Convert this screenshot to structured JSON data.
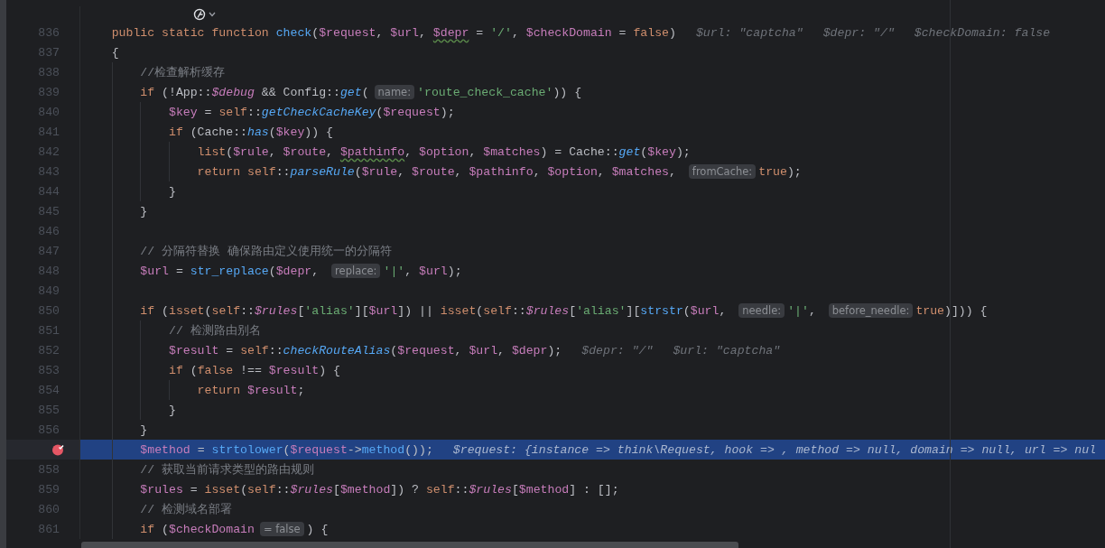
{
  "editor": {
    "lines": [
      {
        "number": "836",
        "tokens": [
          {
            "text": "    public static function ",
            "kind": "kw"
          },
          {
            "text": "check",
            "kind": "fn"
          },
          {
            "text": "(",
            "kind": "txt"
          },
          {
            "text": "$request",
            "kind": "var"
          },
          {
            "text": ", ",
            "kind": "txt"
          },
          {
            "text": "$url",
            "kind": "var"
          },
          {
            "text": ", ",
            "kind": "txt"
          },
          {
            "text": "$depr",
            "kind": "var",
            "warn": true
          },
          {
            "text": " = ",
            "kind": "txt"
          },
          {
            "text": "'/'",
            "kind": "str"
          },
          {
            "text": ", ",
            "kind": "txt"
          },
          {
            "text": "$checkDomain",
            "kind": "var"
          },
          {
            "text": " = ",
            "kind": "txt"
          },
          {
            "text": "false",
            "kind": "kw"
          },
          {
            "text": ")",
            "kind": "txt"
          },
          {
            "text": "$url: \"captcha\"",
            "kind": "val"
          },
          {
            "text": "$depr: \"/\"",
            "kind": "val"
          },
          {
            "text": "$checkDomain: false",
            "kind": "val"
          }
        ]
      },
      {
        "number": "837",
        "tokens": [
          {
            "text": "    {",
            "kind": "txt"
          }
        ]
      },
      {
        "number": "838",
        "tokens": [
          {
            "text": "        //检查解析缓存",
            "kind": "cmt"
          }
        ]
      },
      {
        "number": "839",
        "tokens": [
          {
            "text": "        if",
            "kind": "kw"
          },
          {
            "text": " (!App::",
            "kind": "txt"
          },
          {
            "text": "$debug",
            "kind": "ivar"
          },
          {
            "text": " && Config::",
            "kind": "txt"
          },
          {
            "text": "get",
            "kind": "ifn"
          },
          {
            "text": "(",
            "kind": "txt"
          },
          {
            "text": "name:",
            "kind": "hint"
          },
          {
            "text": "'route_check_cache'",
            "kind": "str"
          },
          {
            "text": ")) {",
            "kind": "txt"
          }
        ]
      },
      {
        "number": "840",
        "tokens": [
          {
            "text": "            $key",
            "kind": "var"
          },
          {
            "text": " = ",
            "kind": "txt"
          },
          {
            "text": "self",
            "kind": "kw"
          },
          {
            "text": "::",
            "kind": "txt"
          },
          {
            "text": "getCheckCacheKey",
            "kind": "ifn"
          },
          {
            "text": "(",
            "kind": "txt"
          },
          {
            "text": "$request",
            "kind": "var"
          },
          {
            "text": ");",
            "kind": "txt"
          }
        ]
      },
      {
        "number": "841",
        "tokens": [
          {
            "text": "            if",
            "kind": "kw"
          },
          {
            "text": " (Cache::",
            "kind": "txt"
          },
          {
            "text": "has",
            "kind": "ifn"
          },
          {
            "text": "(",
            "kind": "txt"
          },
          {
            "text": "$key",
            "kind": "var"
          },
          {
            "text": ")) {",
            "kind": "txt"
          }
        ]
      },
      {
        "number": "842",
        "tokens": [
          {
            "text": "                list",
            "kind": "kw"
          },
          {
            "text": "(",
            "kind": "txt"
          },
          {
            "text": "$rule",
            "kind": "var"
          },
          {
            "text": ", ",
            "kind": "txt"
          },
          {
            "text": "$route",
            "kind": "var"
          },
          {
            "text": ", ",
            "kind": "txt"
          },
          {
            "text": "$pathinfo",
            "kind": "var",
            "warn": true
          },
          {
            "text": ", ",
            "kind": "txt"
          },
          {
            "text": "$option",
            "kind": "var"
          },
          {
            "text": ", ",
            "kind": "txt"
          },
          {
            "text": "$matches",
            "kind": "var"
          },
          {
            "text": ") = Cache::",
            "kind": "txt"
          },
          {
            "text": "get",
            "kind": "ifn"
          },
          {
            "text": "(",
            "kind": "txt"
          },
          {
            "text": "$key",
            "kind": "var"
          },
          {
            "text": ");",
            "kind": "txt"
          }
        ]
      },
      {
        "number": "843",
        "tokens": [
          {
            "text": "                return ",
            "kind": "kw"
          },
          {
            "text": "self",
            "kind": "kw"
          },
          {
            "text": "::",
            "kind": "txt"
          },
          {
            "text": "parseRule",
            "kind": "ifn"
          },
          {
            "text": "(",
            "kind": "txt"
          },
          {
            "text": "$rule",
            "kind": "var"
          },
          {
            "text": ", ",
            "kind": "txt"
          },
          {
            "text": "$route",
            "kind": "var"
          },
          {
            "text": ", ",
            "kind": "txt"
          },
          {
            "text": "$pathinfo",
            "kind": "var"
          },
          {
            "text": ", ",
            "kind": "txt"
          },
          {
            "text": "$option",
            "kind": "var"
          },
          {
            "text": ", ",
            "kind": "txt"
          },
          {
            "text": "$matches",
            "kind": "var"
          },
          {
            "text": ", ",
            "kind": "txt"
          },
          {
            "text": "fromCache:",
            "kind": "hint"
          },
          {
            "text": "true",
            "kind": "kw"
          },
          {
            "text": ");",
            "kind": "txt"
          }
        ]
      },
      {
        "number": "844",
        "tokens": [
          {
            "text": "            }",
            "kind": "txt"
          }
        ]
      },
      {
        "number": "845",
        "tokens": [
          {
            "text": "        }",
            "kind": "txt"
          }
        ]
      },
      {
        "number": "846"
      },
      {
        "number": "847",
        "tokens": [
          {
            "text": "        // 分隔符替换 确保路由定义使用统一的分隔符",
            "kind": "cmt"
          }
        ]
      },
      {
        "number": "848",
        "tokens": [
          {
            "text": "        $url",
            "kind": "var"
          },
          {
            "text": " = ",
            "kind": "txt"
          },
          {
            "text": "str_replace",
            "kind": "fn"
          },
          {
            "text": "(",
            "kind": "txt"
          },
          {
            "text": "$depr",
            "kind": "var"
          },
          {
            "text": ", ",
            "kind": "txt"
          },
          {
            "text": "replace:",
            "kind": "hint"
          },
          {
            "text": "'|'",
            "kind": "str"
          },
          {
            "text": ", ",
            "kind": "txt"
          },
          {
            "text": "$url",
            "kind": "var"
          },
          {
            "text": ");",
            "kind": "txt"
          }
        ]
      },
      {
        "number": "849"
      },
      {
        "number": "850",
        "tokens": [
          {
            "text": "        if",
            "kind": "kw"
          },
          {
            "text": " (",
            "kind": "txt"
          },
          {
            "text": "isset",
            "kind": "kw"
          },
          {
            "text": "(",
            "kind": "txt"
          },
          {
            "text": "self",
            "kind": "kw"
          },
          {
            "text": "::",
            "kind": "txt"
          },
          {
            "text": "$rules",
            "kind": "ivar"
          },
          {
            "text": "[",
            "kind": "txt"
          },
          {
            "text": "'alias'",
            "kind": "str"
          },
          {
            "text": "][",
            "kind": "txt"
          },
          {
            "text": "$url",
            "kind": "var"
          },
          {
            "text": "]) || ",
            "kind": "txt"
          },
          {
            "text": "isset",
            "kind": "kw"
          },
          {
            "text": "(",
            "kind": "txt"
          },
          {
            "text": "self",
            "kind": "kw"
          },
          {
            "text": "::",
            "kind": "txt"
          },
          {
            "text": "$rules",
            "kind": "ivar"
          },
          {
            "text": "[",
            "kind": "txt"
          },
          {
            "text": "'alias'",
            "kind": "str"
          },
          {
            "text": "][",
            "kind": "txt"
          },
          {
            "text": "strstr",
            "kind": "fn"
          },
          {
            "text": "(",
            "kind": "txt"
          },
          {
            "text": "$url",
            "kind": "var"
          },
          {
            "text": ", ",
            "kind": "txt"
          },
          {
            "text": "needle:",
            "kind": "hint"
          },
          {
            "text": "'|'",
            "kind": "str"
          },
          {
            "text": ", ",
            "kind": "txt"
          },
          {
            "text": "before_needle:",
            "kind": "hint"
          },
          {
            "text": "true",
            "kind": "kw"
          },
          {
            "text": ")])) {",
            "kind": "txt"
          }
        ]
      },
      {
        "number": "851",
        "tokens": [
          {
            "text": "            // 检测路由别名",
            "kind": "cmt"
          }
        ]
      },
      {
        "number": "852",
        "tokens": [
          {
            "text": "            $result",
            "kind": "var"
          },
          {
            "text": " = ",
            "kind": "txt"
          },
          {
            "text": "self",
            "kind": "kw"
          },
          {
            "text": "::",
            "kind": "txt"
          },
          {
            "text": "checkRouteAlias",
            "kind": "ifn"
          },
          {
            "text": "(",
            "kind": "txt"
          },
          {
            "text": "$request",
            "kind": "var"
          },
          {
            "text": ", ",
            "kind": "txt"
          },
          {
            "text": "$url",
            "kind": "var"
          },
          {
            "text": ", ",
            "kind": "txt"
          },
          {
            "text": "$depr",
            "kind": "var"
          },
          {
            "text": ");",
            "kind": "txt"
          },
          {
            "text": "$depr: \"/\"",
            "kind": "val"
          },
          {
            "text": "$url: \"captcha\"",
            "kind": "val"
          }
        ]
      },
      {
        "number": "853",
        "tokens": [
          {
            "text": "            if",
            "kind": "kw"
          },
          {
            "text": " (",
            "kind": "txt"
          },
          {
            "text": "false",
            "kind": "kw"
          },
          {
            "text": " !== ",
            "kind": "txt"
          },
          {
            "text": "$result",
            "kind": "var"
          },
          {
            "text": ") {",
            "kind": "txt"
          }
        ]
      },
      {
        "number": "854",
        "tokens": [
          {
            "text": "                return ",
            "kind": "kw"
          },
          {
            "text": "$result",
            "kind": "var"
          },
          {
            "text": ";",
            "kind": "txt"
          }
        ]
      },
      {
        "number": "855",
        "tokens": [
          {
            "text": "            }",
            "kind": "txt"
          }
        ]
      },
      {
        "number": "856",
        "tokens": [
          {
            "text": "        }",
            "kind": "txt"
          }
        ]
      },
      {
        "breakpoint": true,
        "current": true,
        "tokens": [
          {
            "text": "        $method",
            "kind": "var"
          },
          {
            "text": " = ",
            "kind": "txt"
          },
          {
            "text": "strtolower",
            "kind": "fn"
          },
          {
            "text": "(",
            "kind": "txt"
          },
          {
            "text": "$request",
            "kind": "var"
          },
          {
            "text": "->",
            "kind": "txt"
          },
          {
            "text": "method",
            "kind": "fn"
          },
          {
            "text": "());",
            "kind": "txt"
          },
          {
            "text": "$request: {instance => think\\Request, hook => , method => null, domain => null, url => nul",
            "kind": "val"
          }
        ]
      },
      {
        "number": "858",
        "tokens": [
          {
            "text": "        // 获取当前请求类型的路由规则",
            "kind": "cmt"
          }
        ]
      },
      {
        "number": "859",
        "tokens": [
          {
            "text": "        $rules",
            "kind": "var"
          },
          {
            "text": " = ",
            "kind": "txt"
          },
          {
            "text": "isset",
            "kind": "kw"
          },
          {
            "text": "(",
            "kind": "txt"
          },
          {
            "text": "self",
            "kind": "kw"
          },
          {
            "text": "::",
            "kind": "txt"
          },
          {
            "text": "$rules",
            "kind": "ivar"
          },
          {
            "text": "[",
            "kind": "txt"
          },
          {
            "text": "$method",
            "kind": "var"
          },
          {
            "text": "]) ? ",
            "kind": "txt"
          },
          {
            "text": "self",
            "kind": "kw"
          },
          {
            "text": "::",
            "kind": "txt"
          },
          {
            "text": "$rules",
            "kind": "ivar"
          },
          {
            "text": "[",
            "kind": "txt"
          },
          {
            "text": "$method",
            "kind": "var"
          },
          {
            "text": "] : [];",
            "kind": "txt"
          }
        ]
      },
      {
        "number": "860",
        "tokens": [
          {
            "text": "        // 检测域名部署",
            "kind": "cmt"
          }
        ]
      },
      {
        "number": "861",
        "tokens": [
          {
            "text": "        if",
            "kind": "kw"
          },
          {
            "text": " (",
            "kind": "txt"
          },
          {
            "text": "$checkDomain",
            "kind": "var"
          },
          {
            "text": "= false",
            "kind": "hint"
          },
          {
            "text": ") {",
            "kind": "txt"
          }
        ]
      }
    ]
  }
}
